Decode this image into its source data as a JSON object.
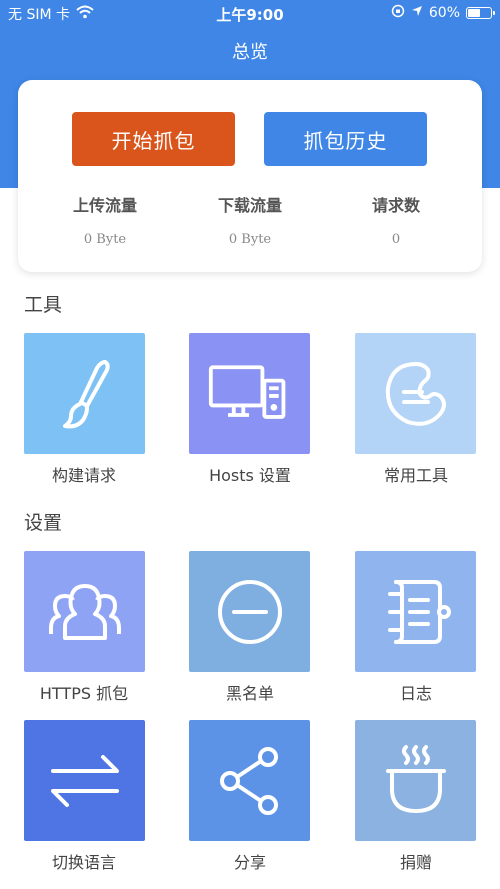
{
  "status_bar": {
    "carrier": "无 SIM 卡",
    "time": "上午9:00",
    "battery": "60%",
    "battery_level": 0.6
  },
  "nav": {
    "title": "总览"
  },
  "overview": {
    "start_button": "开始抓包",
    "history_button": "抓包历史",
    "stats": [
      {
        "label": "上传流量",
        "value": "0 Byte"
      },
      {
        "label": "下载流量",
        "value": "0 Byte"
      },
      {
        "label": "请求数",
        "value": "0"
      }
    ]
  },
  "tools": {
    "title": "工具",
    "items": [
      {
        "label": "构建请求",
        "icon": "paintbrush-icon",
        "color": "#7ec1f5"
      },
      {
        "label": "Hosts 设置",
        "icon": "computer-icon",
        "color": "#8a93f3"
      },
      {
        "label": "常用工具",
        "icon": "palette-icon",
        "color": "#b3d4f7"
      }
    ]
  },
  "settings": {
    "title": "设置",
    "items": [
      {
        "label": "HTTPS 抓包",
        "icon": "users-icon",
        "color": "#8fa3f5"
      },
      {
        "label": "黑名单",
        "icon": "minus-circle-icon",
        "color": "#7faee0"
      },
      {
        "label": "日志",
        "icon": "notebook-icon",
        "color": "#8fb4ee"
      },
      {
        "label": "切换语言",
        "icon": "swap-arrows-icon",
        "color": "#4f74e3"
      },
      {
        "label": "分享",
        "icon": "share-icon",
        "color": "#5d93e6"
      },
      {
        "label": "捐赠",
        "icon": "coffee-cup-icon",
        "color": "#8bb2e0"
      }
    ]
  }
}
